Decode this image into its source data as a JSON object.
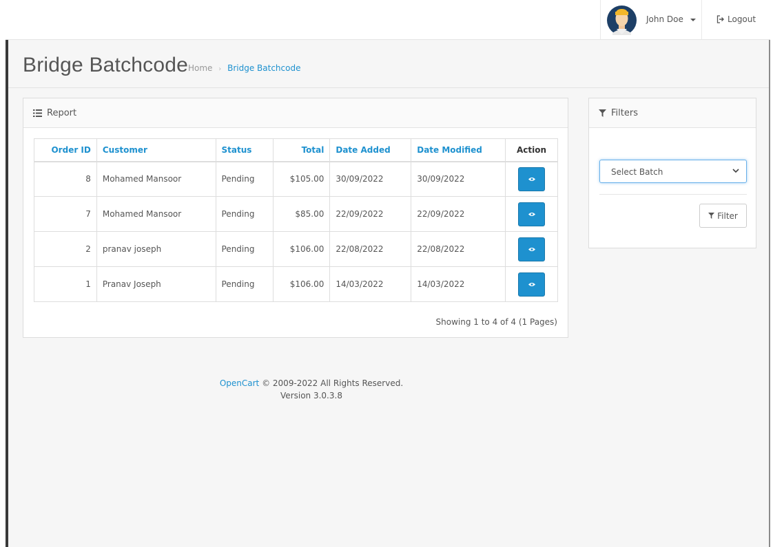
{
  "header": {
    "user_name": "John Doe",
    "logout_label": "Logout"
  },
  "page": {
    "title": "Bridge Batchcode",
    "breadcrumb": [
      {
        "label": "Home"
      },
      {
        "label": "Bridge Batchcode"
      }
    ]
  },
  "report": {
    "heading": "Report",
    "columns": [
      "Order ID",
      "Customer",
      "Status",
      "Total",
      "Date Added",
      "Date Modified",
      "Action"
    ],
    "rows": [
      {
        "order_id": "8",
        "customer": "Mohamed Mansoor",
        "status": "Pending",
        "total": "$105.00",
        "date_added": "30/09/2022",
        "date_modified": "30/09/2022"
      },
      {
        "order_id": "7",
        "customer": "Mohamed Mansoor",
        "status": "Pending",
        "total": "$85.00",
        "date_added": "22/09/2022",
        "date_modified": "22/09/2022"
      },
      {
        "order_id": "2",
        "customer": "pranav joseph",
        "status": "Pending",
        "total": "$106.00",
        "date_added": "22/08/2022",
        "date_modified": "22/08/2022"
      },
      {
        "order_id": "1",
        "customer": "Pranav Joseph",
        "status": "Pending",
        "total": "$106.00",
        "date_added": "14/03/2022",
        "date_modified": "14/03/2022"
      }
    ],
    "pagination_text": "Showing 1 to 4 of 4 (1 Pages)"
  },
  "filters": {
    "heading": "Filters",
    "batch_select_value": "Select Batch",
    "filter_button_label": "Filter"
  },
  "footer": {
    "brand": "OpenCart",
    "copyright": "© 2009-2022 All Rights Reserved.",
    "version": "Version 3.0.3.8"
  },
  "colors": {
    "accent": "#1e91cf",
    "background": "#f6f6f6",
    "text": "#555555"
  },
  "icons": {
    "avatar": "user-avatar",
    "logout": "sign-out-icon",
    "report": "list-icon",
    "filters": "filter-icon",
    "view": "eye-icon"
  }
}
